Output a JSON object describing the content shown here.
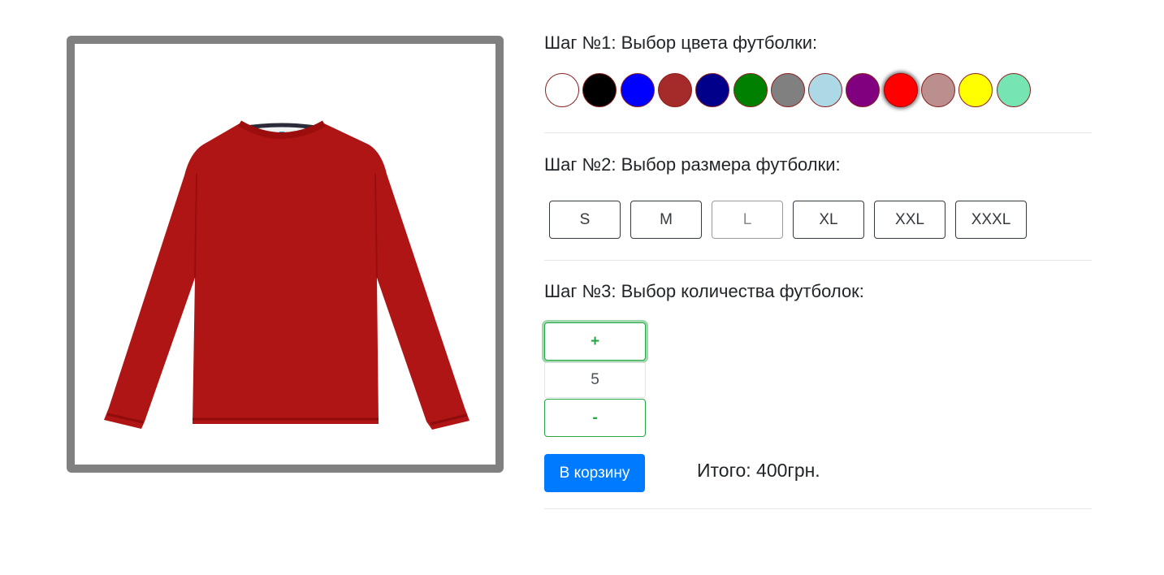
{
  "product": {
    "image_alt": "red-long-sleeve-tshirt",
    "frame_color": "#808080",
    "shirt_color": "#b01515"
  },
  "step1": {
    "title": "Шаг №1: Выбор цвета футболки:",
    "colors": [
      "#ffffff",
      "#000000",
      "#0000ff",
      "#a52a2a",
      "#00008b",
      "#008000",
      "#808080",
      "#add8e6",
      "#800080",
      "#ff0000",
      "#bc8f8f",
      "#ffff00",
      "#77e4b4"
    ],
    "selected_index": 9
  },
  "step2": {
    "title": "Шаг №2: Выбор размера футболки:",
    "sizes": [
      {
        "label": "S",
        "available": true
      },
      {
        "label": "M",
        "available": true
      },
      {
        "label": "L",
        "available": false
      },
      {
        "label": "XL",
        "available": true
      },
      {
        "label": "XXL",
        "available": true
      },
      {
        "label": "XXXL",
        "available": true
      }
    ]
  },
  "step3": {
    "title": "Шаг №3: Выбор количества футболок:",
    "plus_label": "+",
    "minus_label": "-",
    "quantity": "5"
  },
  "cart": {
    "button_label": "В корзину",
    "total_label": "Итого: 400грн."
  }
}
